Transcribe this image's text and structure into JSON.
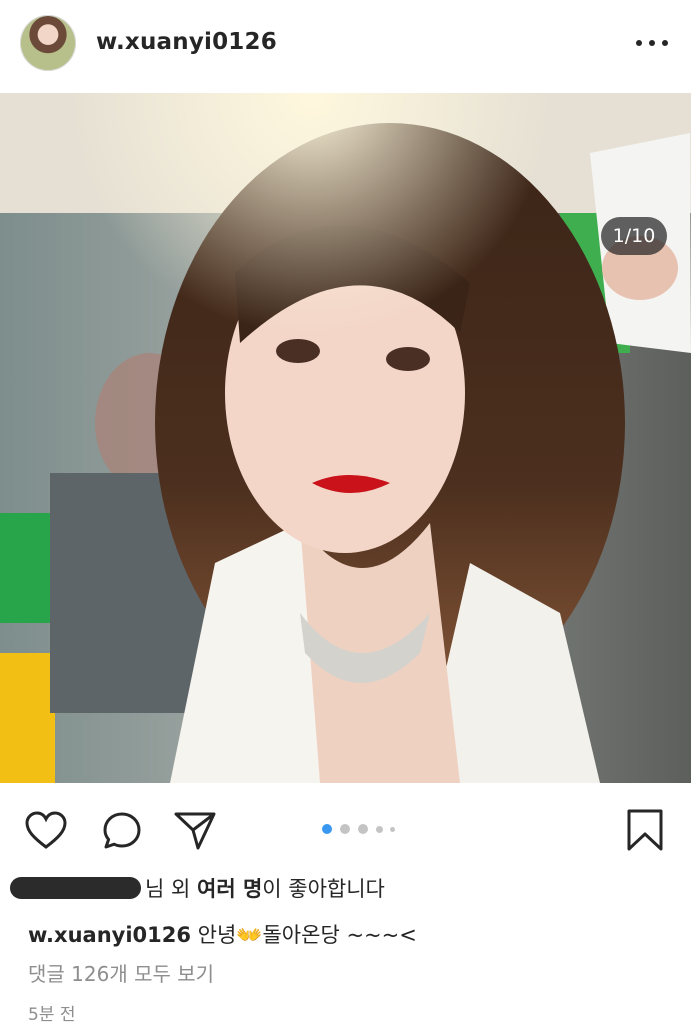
{
  "post": {
    "username": "w.xuanyi0126",
    "photo_counter": "1/10",
    "carousel": {
      "total_dots": 5,
      "active_index": 0
    }
  },
  "likes": {
    "suffix": "님 외 ",
    "bold": "여러 명",
    "end": "이 좋아합니다"
  },
  "caption": {
    "username": "w.xuanyi0126",
    "text_start": " 안녕",
    "emoji": "👐",
    "text_end": "돌아온당 ~~~<"
  },
  "comments_link": "댓글 126개 모두 보기",
  "timestamp": "5분 전",
  "icons": {
    "more": "more-horizontal-icon",
    "like": "heart-icon",
    "comment": "comment-icon",
    "share": "send-icon",
    "save": "bookmark-icon"
  },
  "colors": {
    "text": "#262626",
    "muted": "#8e8e8e",
    "active_dot": "#3897f0",
    "inactive_dot": "#c4c4c4"
  }
}
